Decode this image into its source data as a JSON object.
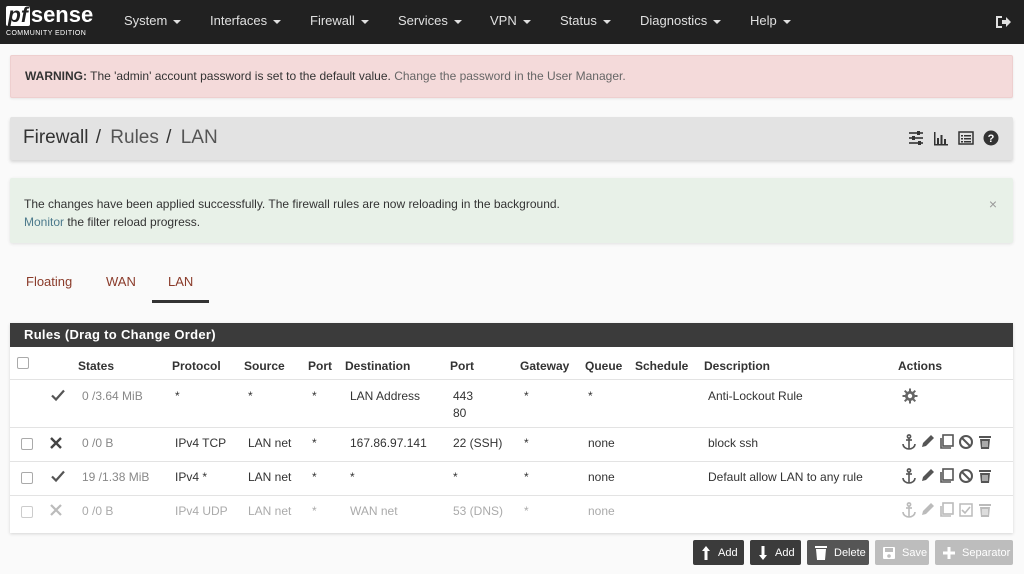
{
  "brand": {
    "pf": "pf",
    "sense": "sense",
    "edition": "COMMUNITY EDITION"
  },
  "nav": [
    "System",
    "Interfaces",
    "Firewall",
    "Services",
    "VPN",
    "Status",
    "Diagnostics",
    "Help"
  ],
  "warning": {
    "label": "WARNING:",
    "text": " The 'admin' account password is set to the default value. ",
    "link": "Change the password in the User Manager."
  },
  "breadcrumb": {
    "part1": "Firewall",
    "sep1": "/",
    "part2": "Rules",
    "sep2": "/",
    "part3": "LAN"
  },
  "success": {
    "line1": "The changes have been applied successfully. The firewall rules are now reloading in the background.",
    "monitor": "Monitor",
    "line2_rest": " the filter reload progress.",
    "close": "×"
  },
  "tabs": [
    "Floating",
    "WAN",
    "LAN"
  ],
  "panel": {
    "title": "Rules (Drag to Change Order)",
    "columns": [
      "States",
      "Protocol",
      "Source",
      "Port",
      "Destination",
      "Port",
      "Gateway",
      "Queue",
      "Schedule",
      "Description",
      "Actions"
    ]
  },
  "rules": [
    {
      "states": "0 /3.64 MiB",
      "protocol": "*",
      "source": "*",
      "port": "*",
      "destination": "LAN Address",
      "dest_port": "443",
      "dest_port2": "80",
      "gateway": "*",
      "queue": "*",
      "schedule": "",
      "description": "Anti-Lockout Rule",
      "action": "pass",
      "enabled": true
    },
    {
      "states": "0 /0 B",
      "protocol": "IPv4 TCP",
      "source": "LAN net",
      "port": "*",
      "destination": "167.86.97.141",
      "dest_port": "22 (SSH)",
      "gateway": "*",
      "queue": "none",
      "schedule": "",
      "description": "block ssh",
      "action": "block",
      "enabled": true
    },
    {
      "states": "19 /1.38 MiB",
      "protocol": "IPv4 *",
      "source": "LAN net",
      "port": "*",
      "destination": "*",
      "dest_port": "*",
      "gateway": "*",
      "queue": "none",
      "schedule": "",
      "description": "Default allow LAN to any rule",
      "action": "pass",
      "enabled": true
    },
    {
      "states": "0 /0 B",
      "protocol": "IPv4 UDP",
      "source": "LAN net",
      "port": "*",
      "destination": "WAN net",
      "dest_port": "53 (DNS)",
      "gateway": "*",
      "queue": "none",
      "schedule": "",
      "description": "",
      "action": "block",
      "enabled": false
    }
  ],
  "buttons": {
    "add_top": "Add",
    "add_bottom": "Add",
    "delete": "Delete",
    "save": "Save",
    "separator": "Separator"
  },
  "colors": {
    "navbar": "#212121",
    "warning_bg": "#f4dada",
    "success_bg": "#e8f1e8",
    "tab_text": "#8a3b2a",
    "pass_icon": "#555555"
  }
}
